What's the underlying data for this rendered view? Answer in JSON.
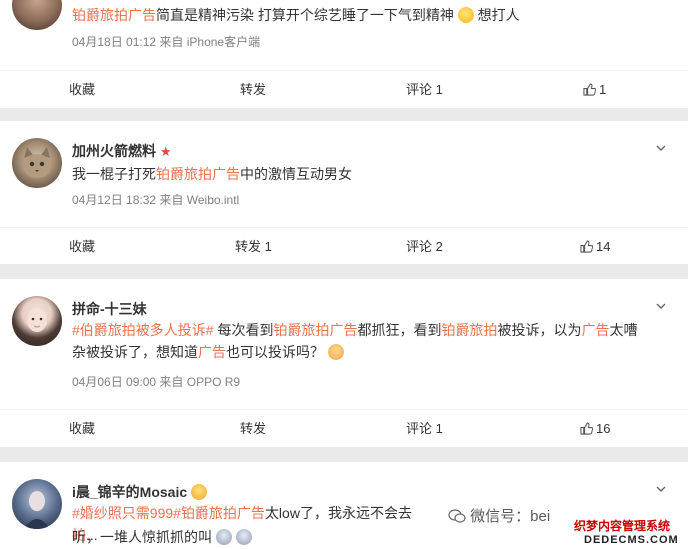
{
  "posts": [
    {
      "content_hl": "铂爵旅拍广告",
      "content_rest": "简直是精神污染 打算开个综艺睡了一下气到精神",
      "content_after": "想打人",
      "time": "04月18日 01:12",
      "source": "来自 iPhone客户端",
      "actions": {
        "collect": "收藏",
        "repost": "转发",
        "comment": "评论 1",
        "like": "1"
      }
    },
    {
      "username": "加州火箭燃料",
      "content_pre": "我一棍子打死",
      "content_hl": "铂爵旅拍广告",
      "content_post": "中的激情互动男女",
      "time": "04月12日 18:32",
      "source": "来自 Weibo.intl",
      "actions": {
        "collect": "收藏",
        "repost": "转发 1",
        "comment": "评论 2",
        "like": "14"
      }
    },
    {
      "username": "拼命-十三妹",
      "tag": "#伯爵旅拍被多人投诉#",
      "seg1": " 每次看到",
      "hl1": "铂爵旅拍广告",
      "seg2": "都抓狂，看到",
      "hl2": "铂爵旅拍",
      "seg3": "被投诉，以为",
      "hl3": "广告",
      "seg4": "太嘈杂被投诉了，想知道",
      "hl4": "广告",
      "seg5": "也可以投诉吗？",
      "time": "04月06日 09:00",
      "source": "来自 OPPO R9",
      "actions": {
        "collect": "收藏",
        "repost": "转发",
        "comment": "评论 1",
        "like": "16"
      }
    },
    {
      "username": "i晨_锦辛的Mosaic",
      "tag": "#婚纱照只需999#",
      "hl1": "铂爵旅拍广告",
      "seg1": "太low了，我永远不会去",
      "hl2": "拍",
      "seg2": "...",
      "line2": "听，一堆人惊抓抓的叫"
    }
  ],
  "watermark": {
    "text": "微信号：bei",
    "logo_line1": "织梦内容管理系统",
    "logo_line2": "DEDECMS.COM"
  },
  "colors": {
    "highlight": "#eb7350",
    "background": "#eaeaea",
    "meta": "#808080"
  }
}
